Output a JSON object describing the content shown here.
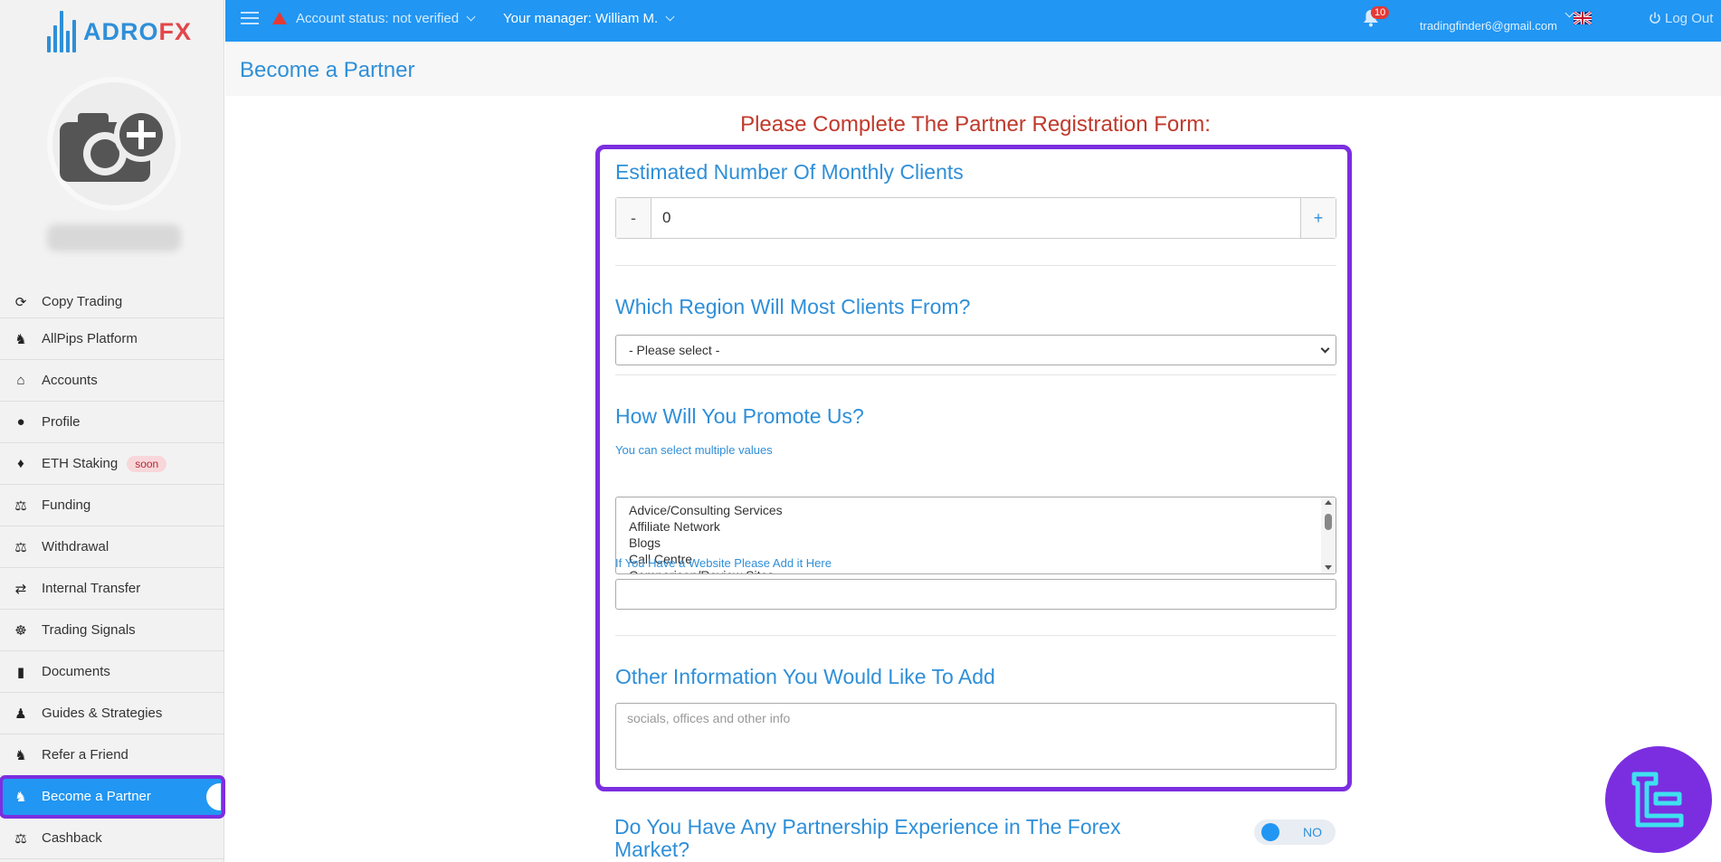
{
  "logo": {
    "part1": "ADRO",
    "part2": "FX"
  },
  "topbar": {
    "account_status": "Account status: not verified",
    "manager": "Your manager: William M.",
    "notifications": "10",
    "email": "tradingfinder6@gmail.com",
    "logout": "Log Out"
  },
  "sidebar": {
    "items": [
      {
        "label": "Copy Trading",
        "icon": "copy-trading-icon"
      },
      {
        "label": "AllPips Platform",
        "icon": "platform-icon"
      },
      {
        "label": "Accounts",
        "icon": "home-icon"
      },
      {
        "label": "Profile",
        "icon": "user-icon"
      },
      {
        "label": "ETH Staking",
        "icon": "ethereum-icon",
        "badge": "soon"
      },
      {
        "label": "Funding",
        "icon": "funding-icon"
      },
      {
        "label": "Withdrawal",
        "icon": "withdrawal-icon"
      },
      {
        "label": "Internal Transfer",
        "icon": "transfer-icon"
      },
      {
        "label": "Trading Signals",
        "icon": "signals-icon"
      },
      {
        "label": "Documents",
        "icon": "document-icon"
      },
      {
        "label": "Guides & Strategies",
        "icon": "guides-icon"
      },
      {
        "label": "Refer a Friend",
        "icon": "refer-icon"
      },
      {
        "label": "Become a Partner",
        "icon": "partner-icon",
        "active": true
      },
      {
        "label": "Cashback",
        "icon": "cashback-icon"
      }
    ]
  },
  "page": {
    "title": "Become a Partner"
  },
  "form": {
    "heading": "Please Complete The Partner Registration Form:",
    "monthly_clients": {
      "question": "Estimated Number Of Monthly Clients",
      "minus": "-",
      "value": "0",
      "plus": "+"
    },
    "region": {
      "question": "Which Region Will Most Clients From?",
      "selected": "- Please select -"
    },
    "promote": {
      "question": "How Will You Promote Us?",
      "hint": "You can select multiple values",
      "options": [
        "Advice/Consulting Services",
        "Affiliate Network",
        "Blogs",
        "Call Centre",
        "Comparison/Review Sites"
      ]
    },
    "website": {
      "label": "If You Have a Website Please Add it Here",
      "value": ""
    },
    "other": {
      "question": "Other Information You Would Like To Add",
      "placeholder": "socials, offices and other info"
    },
    "experience": {
      "question": "Do You Have Any Partnership Experience in The Forex Market?",
      "toggle_label": "NO"
    }
  },
  "colors": {
    "primary": "#2196f3",
    "accent_purple": "#7b2ee0",
    "heading_red": "#c0392b",
    "link_blue": "#2f8fd8"
  }
}
